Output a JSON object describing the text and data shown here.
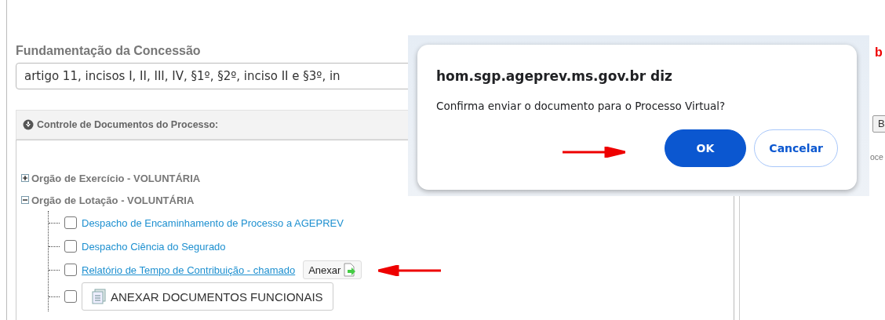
{
  "form": {
    "label": "Fundamentação da Concessão",
    "field_value": "artigo 11, incisos I, II, III, IV, §1º, §2º, inciso II e §3º, in"
  },
  "panel": {
    "title": "Controle de Documentos do Processo:",
    "tree": [
      {
        "label": "Orgão de Exercício - VOLUNTÁRIA",
        "expanded": false
      },
      {
        "label": "Orgão de Lotação - VOLUNTÁRIA",
        "expanded": true,
        "children": [
          {
            "kind": "link",
            "label": "Despacho de Encaminhamento de Processo a AGEPREV",
            "checked": false,
            "hovered": false
          },
          {
            "kind": "link",
            "label": "Despacho Ciência do Segurado",
            "checked": false,
            "hovered": false
          },
          {
            "kind": "link",
            "label": "Relatório de Tempo de Contribuição - chamado",
            "checked": false,
            "hovered": true,
            "action": "Anexar"
          },
          {
            "kind": "button",
            "label": "ANEXAR DOCUMENTOS FUNCIONAIS",
            "checked": false
          }
        ]
      }
    ]
  },
  "background_fragments": {
    "red_text": "b",
    "button": "B",
    "text": "oce"
  },
  "dialog": {
    "title": "hom.sgp.ageprev.ms.gov.br diz",
    "message": "Confirma enviar o documento para o Processo Virtual?",
    "buttons": [
      {
        "label": "OK",
        "primary": true
      },
      {
        "label": "Cancelar",
        "primary": false
      }
    ]
  }
}
